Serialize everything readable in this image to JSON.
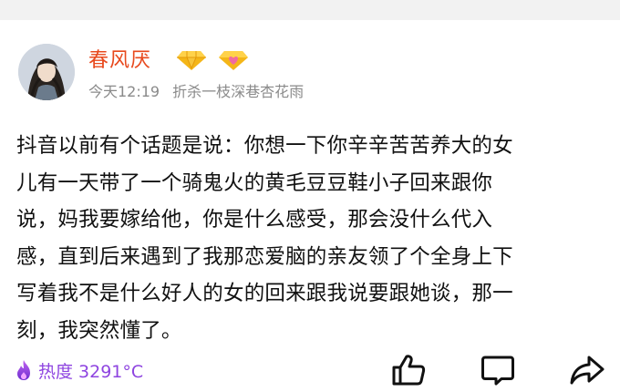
{
  "post": {
    "author": {
      "name": "春风厌",
      "badges": [
        "diamond-badge",
        "heart-diamond-badge"
      ]
    },
    "time": "今天12:19",
    "signature": "折杀一枝深巷杏花雨",
    "content": "抖音以前有个话题是说：你想一下你辛辛苦苦养大的女\n儿有一天带了一个骑鬼火的黄毛豆豆鞋小子回来跟你\n说，妈我要嫁给他，你是什么感受，那会没什么代入\n感，直到后来遇到了我那恋爱脑的亲友领了个全身上下\n写着我不是什么好人的女的回来跟我说要跟她谈，那一\n刻，我突然懂了。",
    "heat": "热度 3291°C"
  },
  "actions": {
    "like_icon": "thumbs-up-icon",
    "comment_icon": "comment-icon",
    "share_icon": "share-arrow-icon"
  },
  "colors": {
    "author_name": "#e8491d",
    "meta_text": "#8a8a8a",
    "heat": "#8e44e0",
    "badge_gold": "#f4b618",
    "badge_pink": "#f06aa0"
  }
}
